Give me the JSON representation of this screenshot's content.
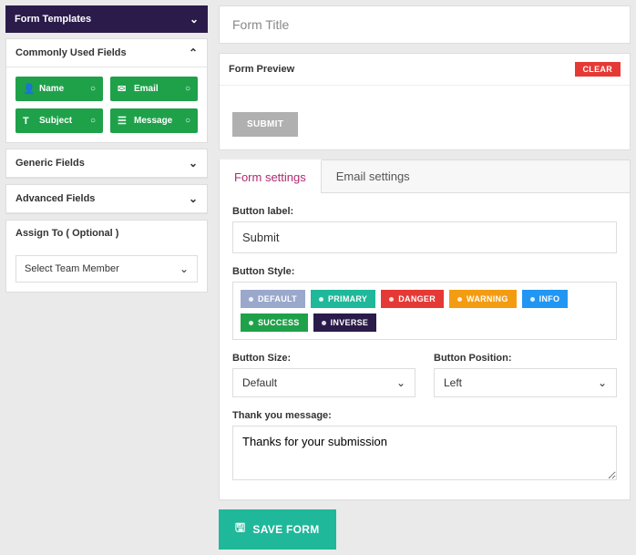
{
  "sidebar": {
    "templates_label": "Form Templates",
    "common_label": "Commonly Used Fields",
    "common_fields": [
      {
        "icon": "👤",
        "label": "Name"
      },
      {
        "icon": "✉",
        "label": "Email"
      },
      {
        "icon": "T",
        "label": "Subject"
      },
      {
        "icon": "☰",
        "label": "Message"
      }
    ],
    "generic_label": "Generic Fields",
    "advanced_label": "Advanced Fields",
    "assign_label": "Assign To ( Optional )",
    "assign_placeholder": "Select Team Member"
  },
  "form_title_placeholder": "Form Title",
  "preview": {
    "label": "Form Preview",
    "clear": "CLEAR",
    "submit": "SUBMIT"
  },
  "tabs": {
    "form": "Form settings",
    "email": "Email settings"
  },
  "settings": {
    "button_label_lbl": "Button label:",
    "button_label_value": "Submit",
    "button_style_lbl": "Button Style:",
    "styles": [
      {
        "label": "DEFAULT",
        "bg": "#9aa8cc"
      },
      {
        "label": "PRIMARY",
        "bg": "#1fb89a"
      },
      {
        "label": "DANGER",
        "bg": "#e53935"
      },
      {
        "label": "WARNING",
        "bg": "#f39c12"
      },
      {
        "label": "INFO",
        "bg": "#2196f3"
      },
      {
        "label": "SUCCESS",
        "bg": "#1fa14a"
      },
      {
        "label": "INVERSE",
        "bg": "#2b1b4a"
      }
    ],
    "button_size_lbl": "Button Size:",
    "button_size_value": "Default",
    "button_pos_lbl": "Button Position:",
    "button_pos_value": "Left",
    "thank_lbl": "Thank you message:",
    "thank_value": "Thanks for your submission"
  },
  "save_label": "SAVE FORM"
}
